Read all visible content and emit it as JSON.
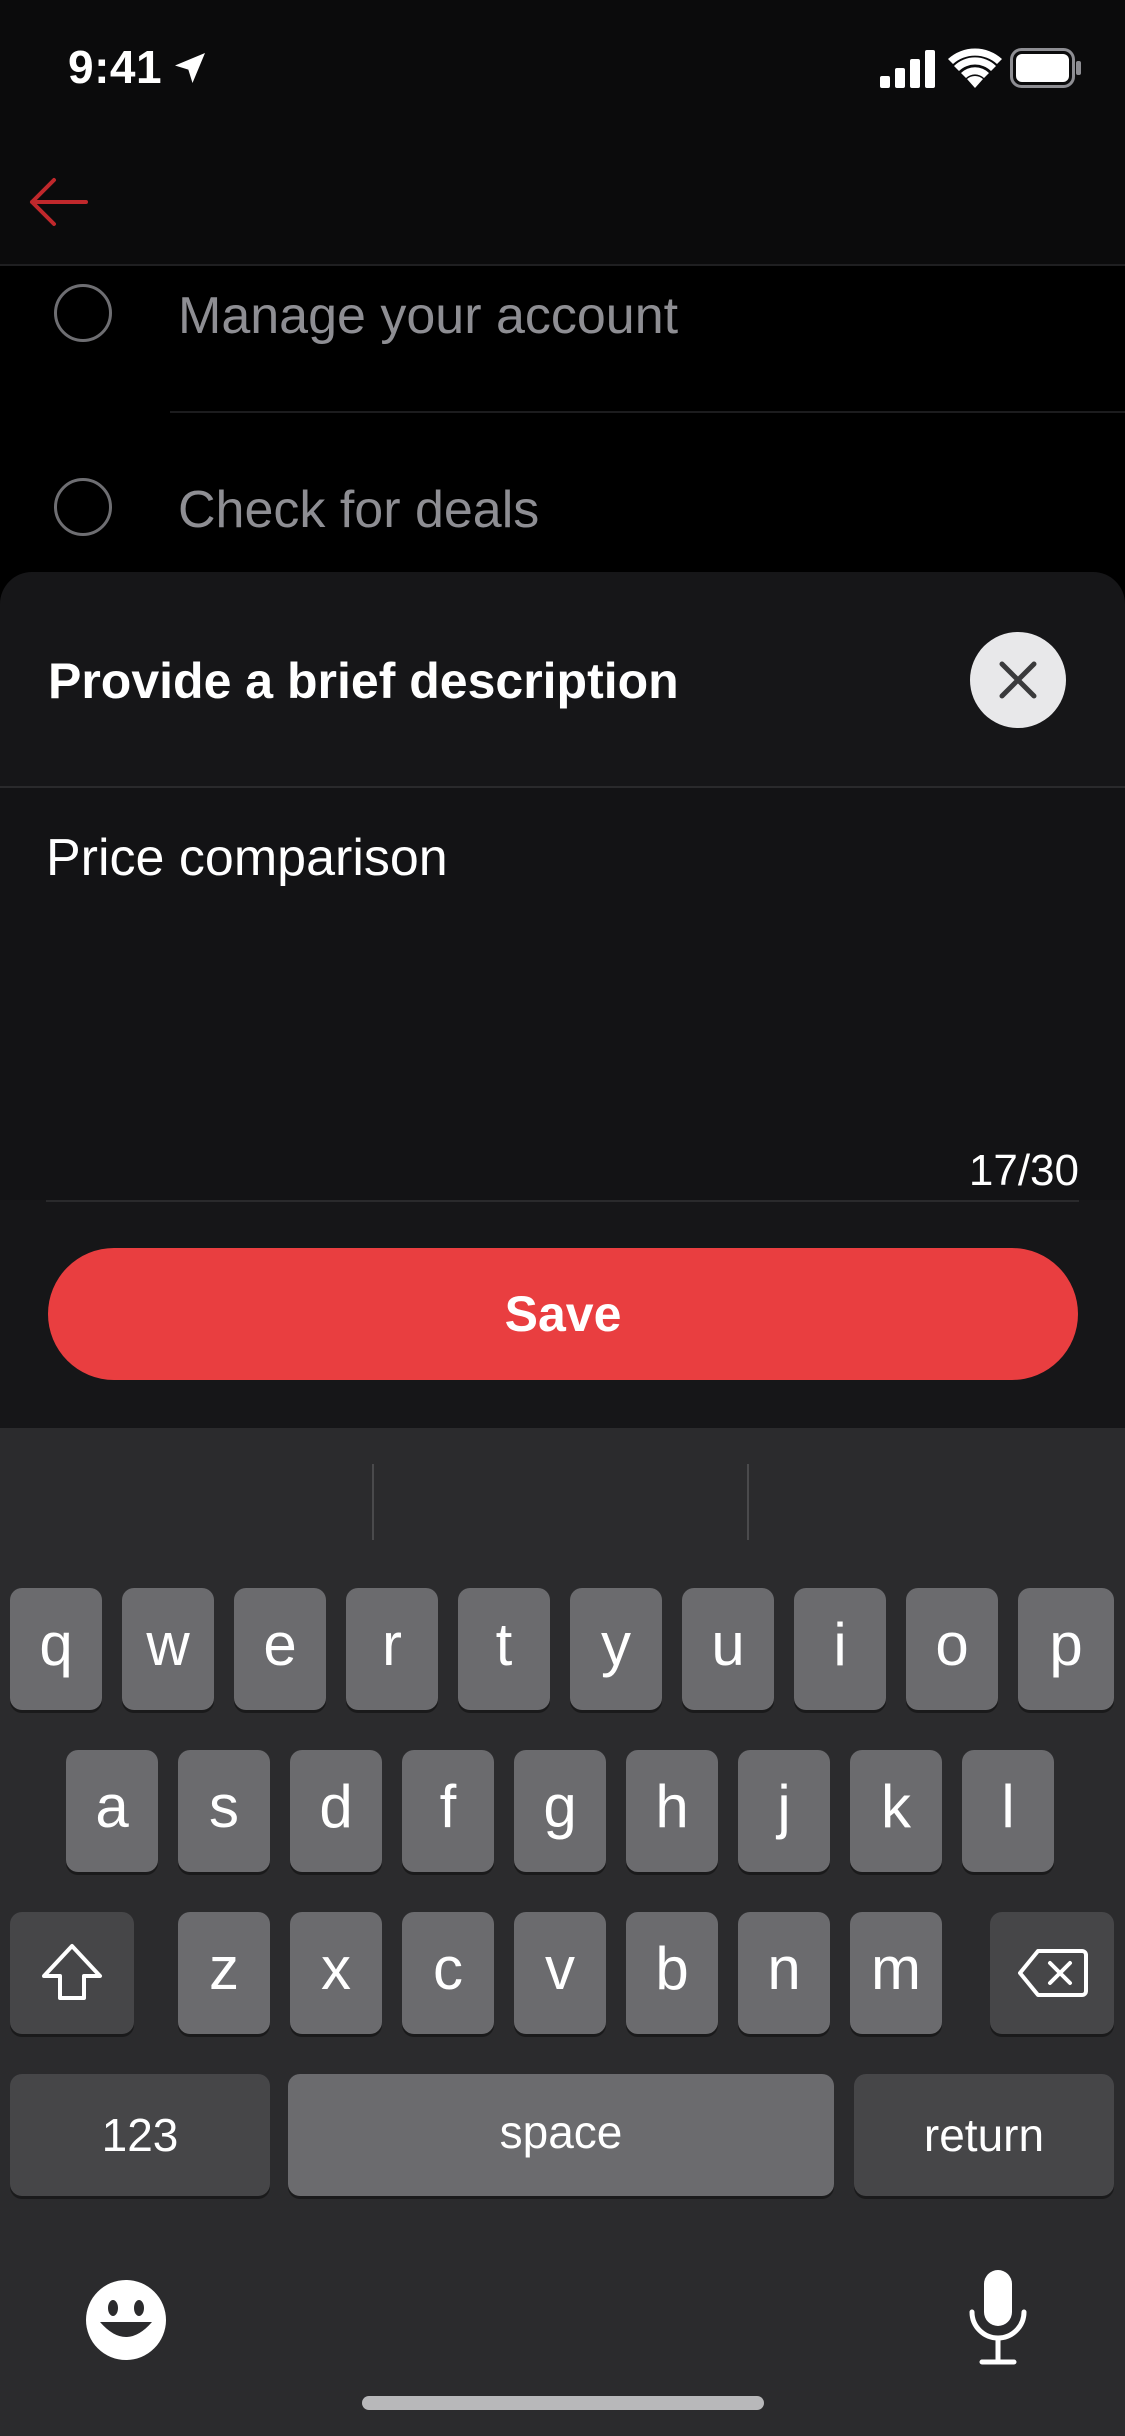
{
  "status_bar": {
    "time": "9:41"
  },
  "list": {
    "items": [
      {
        "label": "Manage your account"
      },
      {
        "label": "Check for deals"
      }
    ]
  },
  "sheet": {
    "title": "Provide a brief description",
    "input_value": "Price comparison",
    "char_count": "17/30",
    "save_label": "Save"
  },
  "keyboard": {
    "row1": [
      "q",
      "w",
      "e",
      "r",
      "t",
      "y",
      "u",
      "i",
      "o",
      "p"
    ],
    "row2": [
      "a",
      "s",
      "d",
      "f",
      "g",
      "h",
      "j",
      "k",
      "l"
    ],
    "row3": [
      "z",
      "x",
      "c",
      "v",
      "b",
      "n",
      "m"
    ],
    "numbers_label": "123",
    "space_label": "space",
    "return_label": "return"
  },
  "colors": {
    "accent": "#e93e40",
    "back_arrow": "#c0282c"
  }
}
